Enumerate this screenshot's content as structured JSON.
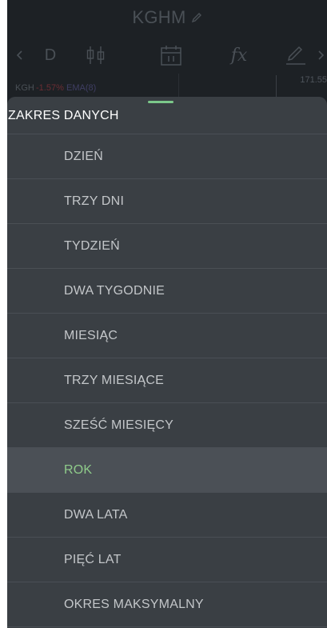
{
  "header": {
    "title": "KGHM",
    "edit_icon": "pencil-icon"
  },
  "toolbar": {
    "period_label": "D",
    "fx_label": "fx",
    "icons": [
      "chevron-left-icon",
      "candlestick-icon",
      "calendar-icon",
      "function-icon",
      "draw-icon",
      "chevron-right-icon"
    ]
  },
  "chart_strip": {
    "ticker": "KGH",
    "change": "-1.57%",
    "indicator": "EMA(8)",
    "price": "171.55"
  },
  "sheet": {
    "title": "ZAKRES DANYCH",
    "options": [
      "DZIEŃ",
      "TRZY DNI",
      "TYDZIEŃ",
      "DWA TYGODNIE",
      "MIESIĄC",
      "TRZY MIESIĄCE",
      "SZEŚĆ MIESIĘCY",
      "ROK",
      "DWA LATA",
      "PIĘĆ LAT",
      "OKRES MAKSYMALNY"
    ],
    "selected": "ROK"
  },
  "colors": {
    "accent": "#8fcb8a",
    "negative": "#6b2d33",
    "sheet_bg": "#3a3f44",
    "selected_bg": "#4b5056"
  }
}
